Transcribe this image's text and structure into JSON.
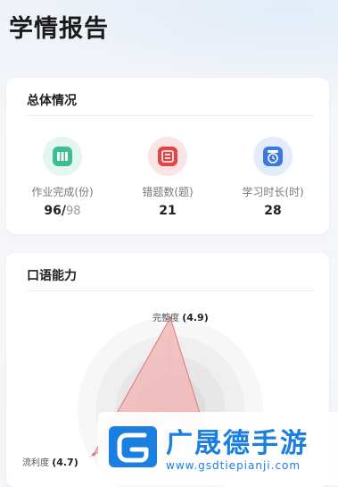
{
  "page": {
    "title": "学情报告"
  },
  "summary": {
    "title": "总体情况",
    "stats": [
      {
        "icon": "book-icon",
        "color": "#3dbd94",
        "bg": "#e3f6ef",
        "label": "作业完成(份)",
        "value": "96/",
        "sub": "98"
      },
      {
        "icon": "wrong-questions-icon",
        "color": "#e24545",
        "bg": "#fbe4e4",
        "label": "错题数(题)",
        "value": "21",
        "sub": ""
      },
      {
        "icon": "clock-icon",
        "color": "#3d78e0",
        "bg": "#e2ecfb",
        "label": "学习时长(时)",
        "value": "28",
        "sub": ""
      }
    ]
  },
  "oral": {
    "title": "口语能力",
    "axes": [
      {
        "name": "完整度",
        "score": "(4.9)"
      },
      {
        "name": "流利度",
        "score": "(4.7)"
      }
    ]
  },
  "chart_data": {
    "type": "radar",
    "max": 5,
    "axes": [
      "完整度",
      "流利度"
    ],
    "values": [
      4.9,
      4.7
    ],
    "fill_color": "#f2b8b8",
    "stroke_color": "#d97a7a"
  },
  "watermark": {
    "name": "广晟德手游",
    "url": "www.gsdtiepianji.com",
    "color": "#1a7fe0"
  }
}
